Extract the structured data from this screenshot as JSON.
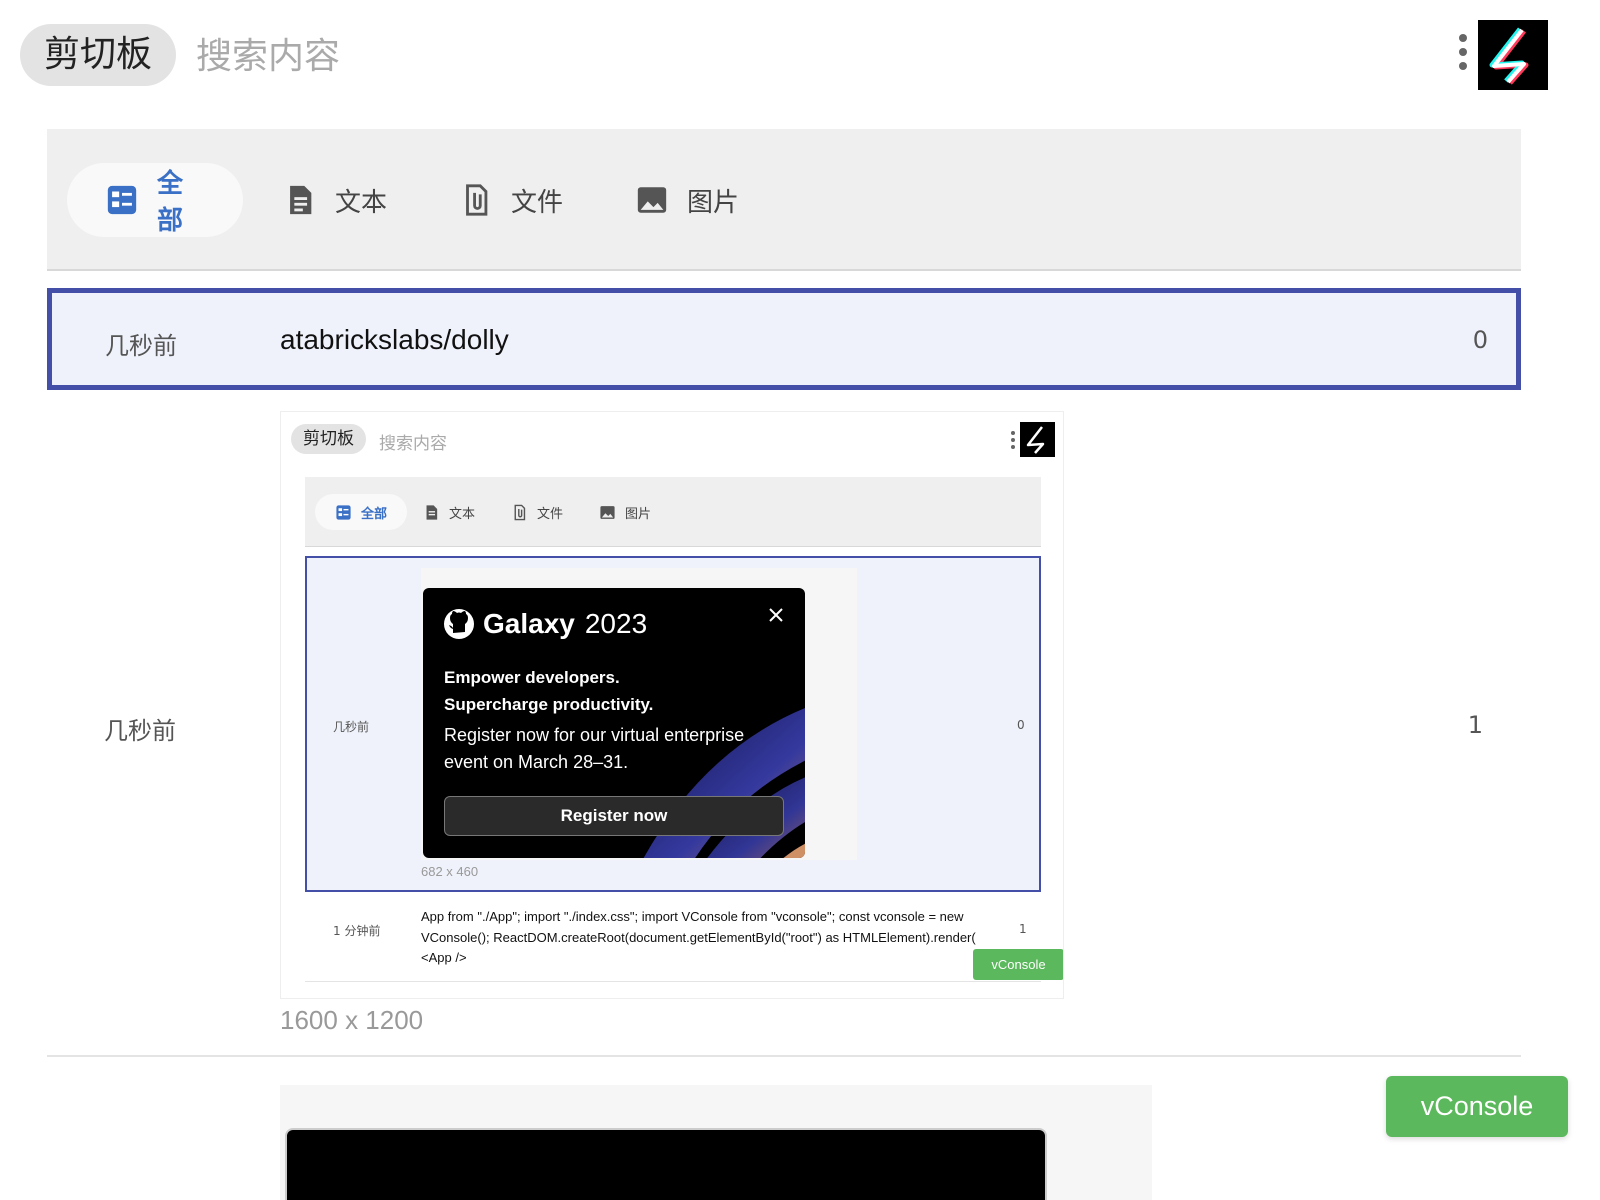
{
  "header": {
    "title": "剪切板",
    "search_placeholder": "搜索内容",
    "more_icon": "more-vertical-icon",
    "logo": "app-logo"
  },
  "tabs": [
    {
      "label": "全部",
      "icon": "list-icon",
      "active": true
    },
    {
      "label": "文本",
      "icon": "document-icon",
      "active": false
    },
    {
      "label": "文件",
      "icon": "attachment-icon",
      "active": false
    },
    {
      "label": "图片",
      "icon": "image-icon",
      "active": false
    }
  ],
  "items": [
    {
      "time": "几秒前",
      "text": "atabrickslabs/dolly",
      "count": "0",
      "selected": true
    },
    {
      "time": "几秒前",
      "type": "image",
      "dims": "1600 x 1200",
      "count": "1"
    }
  ],
  "preview": {
    "title": "剪切板",
    "search_placeholder": "搜索内容",
    "tabs": [
      "全部",
      "文本",
      "文件",
      "图片"
    ],
    "rows": [
      {
        "time": "几秒前",
        "count": "0",
        "dims": "682 x 460",
        "promo": {
          "brand": "Galaxy",
          "year": "2023",
          "headline1": "Empower developers.",
          "headline2": "Supercharge productivity.",
          "body": "Register now for our virtual enterprise event on March 28–31.",
          "button": "Register now"
        }
      },
      {
        "time": "1 分钟前",
        "count": "1",
        "text": "App from \"./App\"; import \"./index.css\"; import VConsole from \"vconsole\"; const vconsole = new VConsole(); ReactDOM.createRoot(document.getElementById(\"root\") as HTMLElement).render( <App />"
      }
    ],
    "vconsole": "vConsole"
  },
  "vconsole": "vConsole",
  "colors": {
    "accent": "#3a70c5",
    "selected_border": "#4450a8",
    "selected_bg": "#eff2fb",
    "vconsole_green": "#5cb85c"
  }
}
